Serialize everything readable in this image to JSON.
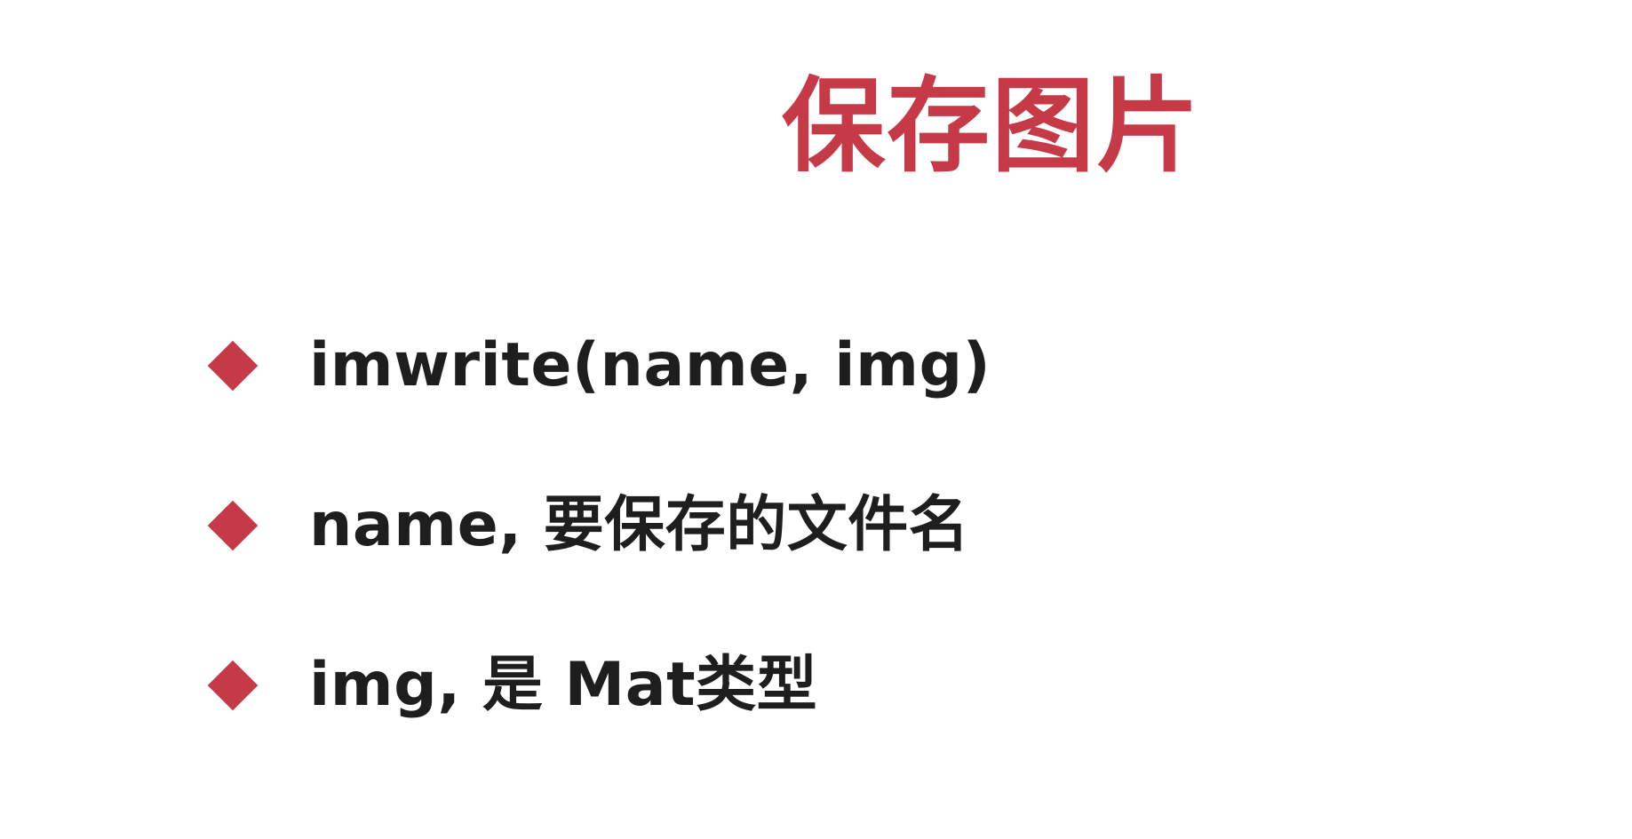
{
  "slide": {
    "title": "保存图片",
    "bullets": [
      {
        "text": "imwrite(name, img)"
      },
      {
        "text": "name, 要保存的文件名"
      },
      {
        "text": "img, 是 Mat类型"
      }
    ]
  },
  "colors": {
    "accent": "#c63a48",
    "text": "#1e1e1e",
    "background": "#ffffff"
  },
  "icons": {
    "bullet": "diamond-bullet-icon"
  }
}
